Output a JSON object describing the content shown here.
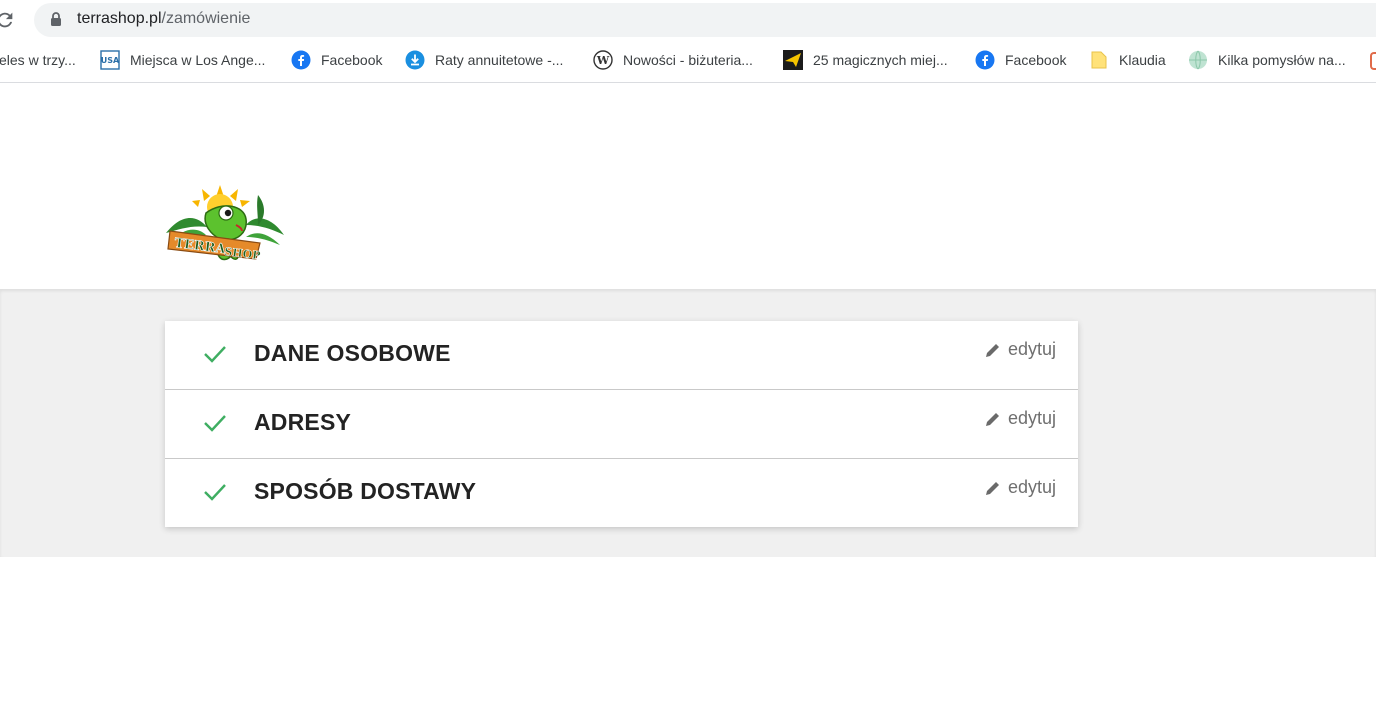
{
  "browser": {
    "url_host": "terrashop.pl",
    "url_path": "/zamówienie",
    "bookmarks": [
      {
        "label": "eles w trzy...",
        "icon": "none"
      },
      {
        "label": "Miejsca w Los Ange...",
        "icon": "usa-flag-icon"
      },
      {
        "label": "Facebook",
        "icon": "facebook-icon"
      },
      {
        "label": "Raty annuitetowe -...",
        "icon": "download-circle-icon"
      },
      {
        "label": "Nowości - biżuteria...",
        "icon": "wordpress-icon"
      },
      {
        "label": "25 magicznych miej...",
        "icon": "paper-plane-icon"
      },
      {
        "label": "Facebook",
        "icon": "facebook-icon"
      },
      {
        "label": "Klaudia",
        "icon": "folder-icon"
      },
      {
        "label": "Kilka pomysłów na...",
        "icon": "globe-icon"
      }
    ]
  },
  "site": {
    "logo_text": "TerraShop"
  },
  "checkout": {
    "edit_label": "edytuj",
    "steps": [
      {
        "title": "DANE OSOBOWE",
        "completed": true
      },
      {
        "title": "ADRESY",
        "completed": true
      },
      {
        "title": "SPOSÓB DOSTAWY",
        "completed": true
      }
    ]
  },
  "colors": {
    "check": "#3fae62",
    "edit_text": "#6f6f6f",
    "section_bg": "#f0f0f0"
  }
}
